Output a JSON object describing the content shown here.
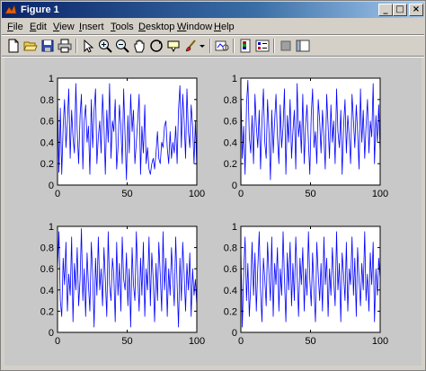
{
  "window": {
    "title": "Figure 1",
    "controls": {
      "minimize": "_",
      "maximize": "□",
      "close": "×"
    }
  },
  "menubar": {
    "items": [
      {
        "label": "File",
        "u": "F",
        "rest": "ile"
      },
      {
        "label": "Edit",
        "u": "E",
        "rest": "dit"
      },
      {
        "label": "View",
        "u": "V",
        "rest": "iew"
      },
      {
        "label": "Insert",
        "u": "I",
        "rest": "nsert"
      },
      {
        "label": "Tools",
        "u": "T",
        "rest": "ools"
      },
      {
        "label": "Desktop",
        "u": "D",
        "rest": "esktop"
      },
      {
        "label": "Window",
        "u": "W",
        "rest": "indow"
      },
      {
        "label": "Help",
        "u": "H",
        "rest": "elp"
      }
    ]
  },
  "toolbar": {
    "icons": [
      "new-figure-icon",
      "open-file-icon",
      "save-icon",
      "print-icon",
      "arrow-icon",
      "zoom-in-icon",
      "zoom-out-icon",
      "pan-icon",
      "rotate-3d-icon",
      "data-cursor-icon",
      "brush-icon",
      "brush-dropdown-icon",
      "link-plot-icon",
      "colorbar-icon",
      "legend-icon",
      "hide-plot-tools-icon",
      "show-plot-tools-icon"
    ]
  },
  "colors": {
    "line": "#0000ff",
    "figure_bg": "#c8c8c8",
    "axes_bg": "#ffffff"
  },
  "chart_data": [
    {
      "type": "line",
      "xlim": [
        0,
        100
      ],
      "ylim": [
        0,
        1
      ],
      "xticks": [
        "0",
        "50",
        "100"
      ],
      "yticks": [
        "0",
        "0.2",
        "0.4",
        "0.6",
        "0.8",
        "1"
      ],
      "series": [
        {
          "values": [
            0.85,
            0.12,
            0.72,
            0.1,
            0.55,
            0.8,
            0.35,
            0.6,
            0.9,
            0.25,
            0.7,
            0.45,
            0.3,
            0.95,
            0.5,
            0.2,
            0.65,
            0.85,
            0.15,
            0.6,
            0.75,
            0.4,
            0.55,
            0.1,
            0.8,
            0.35,
            0.7,
            0.9,
            0.2,
            0.45,
            0.6,
            0.3,
            0.85,
            0.55,
            0.1,
            0.7,
            0.4,
            0.95,
            0.25,
            0.6,
            0.5,
            0.8,
            0.15,
            0.35,
            0.75,
            0.55,
            0.2,
            0.9,
            0.45,
            0.05,
            0.65,
            0.3,
            0.85,
            0.5,
            0.7,
            0.2,
            0.4,
            0.6,
            0.85,
            0.1,
            0.55,
            0.3,
            0.75,
            0.2,
            0.35,
            0.15,
            0.1,
            0.2,
            0.25,
            0.15,
            0.3,
            0.5,
            0.25,
            0.2,
            0.4,
            0.35,
            0.55,
            0.6,
            0.35,
            0.2,
            0.5,
            0.25,
            0.4,
            0.3,
            0.55,
            0.2,
            0.7,
            0.93,
            0.35,
            0.85,
            0.6,
            0.25,
            0.9,
            0.5,
            0.35,
            0.75,
            0.55,
            0.2,
            0.6,
            0.15
          ]
        }
      ]
    },
    {
      "type": "line",
      "xlim": [
        0,
        100
      ],
      "ylim": [
        0,
        1
      ],
      "xticks": [
        "0",
        "50",
        "100"
      ],
      "yticks": [
        "0",
        "0.2",
        "0.4",
        "0.6",
        "0.8",
        "1"
      ],
      "series": [
        {
          "values": [
            0.9,
            0.25,
            0.55,
            0.1,
            0.75,
            0.98,
            0.45,
            0.3,
            0.65,
            0.2,
            0.85,
            0.55,
            0.35,
            0.7,
            0.15,
            0.6,
            0.9,
            0.4,
            0.25,
            0.8,
            0.5,
            0.05,
            0.7,
            0.3,
            0.6,
            0.85,
            0.45,
            0.2,
            0.75,
            0.35,
            0.55,
            0.9,
            0.1,
            0.65,
            0.4,
            0.8,
            0.25,
            0.5,
            0.7,
            0.15,
            0.95,
            0.45,
            0.6,
            0.3,
            0.85,
            0.2,
            0.55,
            0.75,
            0.4,
            0.1,
            0.65,
            0.9,
            0.35,
            0.5,
            0.2,
            0.8,
            0.6,
            0.3,
            0.7,
            0.45,
            0.15,
            0.85,
            0.55,
            0.25,
            0.75,
            0.4,
            0.6,
            0.2,
            0.9,
            0.5,
            0.35,
            0.7,
            0.1,
            0.55,
            0.8,
            0.3,
            0.65,
            0.45,
            0.2,
            0.85,
            0.6,
            0.35,
            0.75,
            0.5,
            0.15,
            0.9,
            0.4,
            0.7,
            0.25,
            0.55,
            0.8,
            0.3,
            0.6,
            0.45,
            0.95,
            0.2,
            0.65,
            0.4,
            0.75,
            0.3
          ]
        }
      ]
    },
    {
      "type": "line",
      "xlim": [
        0,
        100
      ],
      "ylim": [
        0,
        1
      ],
      "xticks": [
        "0",
        "50",
        "100"
      ],
      "yticks": [
        "0",
        "0.2",
        "0.4",
        "0.6",
        "0.8",
        "1"
      ],
      "series": [
        {
          "values": [
            0.6,
            0.95,
            0.3,
            0.15,
            0.7,
            0.45,
            0.85,
            0.2,
            0.55,
            0.35,
            0.9,
            0.1,
            0.65,
            0.4,
            0.8,
            0.25,
            0.5,
            0.98,
            0.3,
            0.6,
            0.15,
            0.75,
            0.45,
            0.2,
            0.85,
            0.55,
            0.05,
            0.7,
            0.35,
            0.9,
            0.4,
            0.6,
            0.25,
            0.8,
            0.5,
            0.15,
            0.95,
            0.45,
            0.3,
            0.7,
            0.55,
            0.1,
            0.85,
            0.35,
            0.65,
            0.2,
            0.9,
            0.5,
            0.4,
            0.75,
            0.25,
            0.6,
            0.05,
            0.8,
            0.45,
            0.3,
            0.95,
            0.55,
            0.2,
            0.7,
            0.35,
            0.85,
            0.15,
            0.6,
            0.4,
            0.9,
            0.25,
            0.75,
            0.5,
            0.1,
            0.65,
            0.3,
            0.85,
            0.55,
            0.2,
            0.95,
            0.4,
            0.7,
            0.15,
            0.6,
            0.35,
            0.8,
            0.5,
            0.25,
            0.9,
            0.45,
            0.05,
            0.7,
            0.3,
            0.85,
            0.55,
            0.2,
            0.65,
            0.4,
            0.75,
            0.15,
            0.6,
            0.35,
            0.5,
            0.25
          ]
        }
      ]
    },
    {
      "type": "line",
      "xlim": [
        0,
        100
      ],
      "ylim": [
        0,
        1
      ],
      "xticks": [
        "0",
        "50",
        "100"
      ],
      "yticks": [
        "0",
        "0.2",
        "0.4",
        "0.6",
        "0.8",
        "1"
      ],
      "series": [
        {
          "values": [
            0.8,
            0.05,
            0.55,
            0.9,
            0.3,
            0.65,
            0.15,
            0.45,
            0.85,
            0.35,
            0.75,
            0.2,
            0.6,
            0.95,
            0.4,
            0.1,
            0.7,
            0.5,
            0.25,
            0.85,
            0.55,
            0.3,
            0.9,
            0.15,
            0.65,
            0.45,
            0.8,
            0.2,
            0.6,
            0.35,
            0.95,
            0.5,
            0.1,
            0.75,
            0.4,
            0.85,
            0.25,
            0.65,
            0.3,
            0.9,
            0.55,
            0.15,
            0.7,
            0.45,
            0.8,
            0.2,
            0.6,
            0.35,
            0.95,
            0.5,
            0.25,
            0.75,
            0.4,
            0.1,
            0.85,
            0.55,
            0.3,
            0.65,
            0.2,
            0.9,
            0.45,
            0.7,
            0.15,
            0.6,
            0.35,
            0.8,
            0.5,
            0.25,
            0.95,
            0.4,
            0.65,
            0.1,
            0.75,
            0.55,
            0.3,
            0.85,
            0.2,
            0.6,
            0.45,
            0.9,
            0.35,
            0.7,
            0.15,
            0.8,
            0.5,
            0.25,
            0.65,
            0.4,
            0.95,
            0.3,
            0.55,
            0.2,
            0.75,
            0.45,
            0.85,
            0.1,
            0.6,
            0.35,
            0.7,
            0.5
          ]
        }
      ]
    }
  ]
}
